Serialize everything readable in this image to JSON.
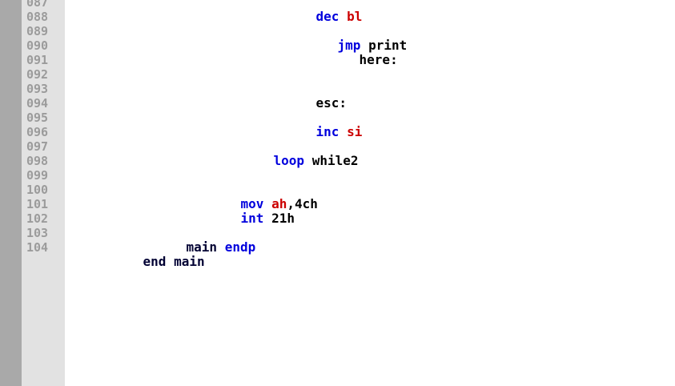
{
  "line_numbers": [
    "087",
    "088",
    "089",
    "090",
    "091",
    "092",
    "093",
    "094",
    "095",
    "096",
    "097",
    "098",
    "099",
    "100",
    "101",
    "102",
    "103",
    "104"
  ],
  "code": {
    "l087_kw": "dec",
    "l087_reg": "bl",
    "l089_kw": "jmp",
    "l089_rest": "print",
    "l090_label": "here:",
    "l093_label": "esc:",
    "l095_kw": "inc",
    "l095_reg": "si",
    "l097_kw": "loop",
    "l097_rest": "while2",
    "l100_kw": "mov",
    "l100_reg": "ah",
    "l100_rest": ",4ch",
    "l101_kw": "int",
    "l101_rest": "21h",
    "l103_name": "main",
    "l103_kw": "endp",
    "l104_kw": "end",
    "l104_name": "main"
  },
  "colors": {
    "keyword": "#0000dd",
    "register": "#cc0000",
    "text": "#000000",
    "line_number": "#9b9b9b"
  }
}
